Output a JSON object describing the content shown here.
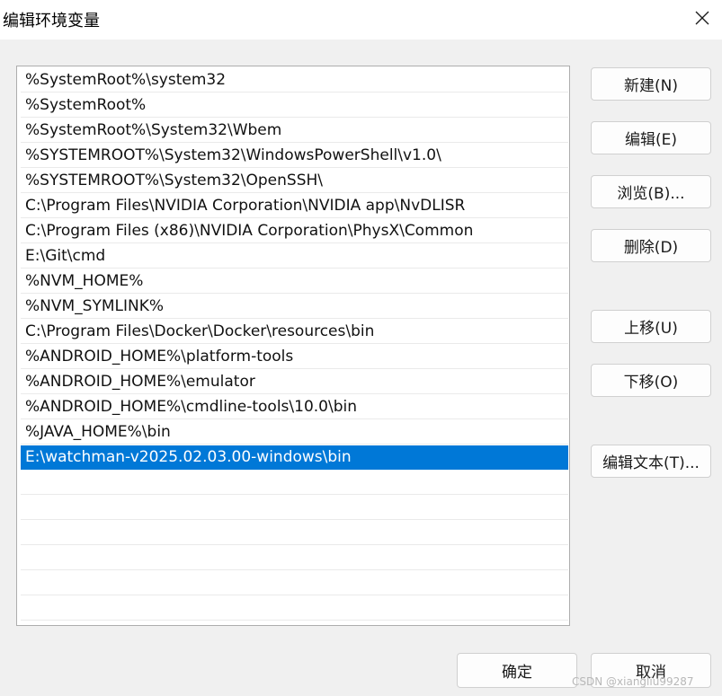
{
  "window": {
    "title": "编辑环境变量"
  },
  "icons": {
    "close": "close-icon"
  },
  "path_list": {
    "items": [
      "%SystemRoot%\\system32",
      "%SystemRoot%",
      "%SystemRoot%\\System32\\Wbem",
      "%SYSTEMROOT%\\System32\\WindowsPowerShell\\v1.0\\",
      "%SYSTEMROOT%\\System32\\OpenSSH\\",
      "C:\\Program Files\\NVIDIA Corporation\\NVIDIA app\\NvDLISR",
      "C:\\Program Files (x86)\\NVIDIA Corporation\\PhysX\\Common",
      "E:\\Git\\cmd",
      "%NVM_HOME%",
      "%NVM_SYMLINK%",
      "C:\\Program Files\\Docker\\Docker\\resources\\bin",
      "%ANDROID_HOME%\\platform-tools",
      "%ANDROID_HOME%\\emulator",
      "%ANDROID_HOME%\\cmdline-tools\\10.0\\bin",
      "%JAVA_HOME%\\bin",
      "E:\\watchman-v2025.02.03.00-windows\\bin"
    ],
    "selected_index": 15,
    "selection_color": "#0078d7"
  },
  "buttons": {
    "new": "新建(N)",
    "edit": "编辑(E)",
    "browse": "浏览(B)...",
    "delete": "删除(D)",
    "move_up": "上移(U)",
    "move_down": "下移(O)",
    "edit_text": "编辑文本(T)..."
  },
  "footer": {
    "ok": "确定",
    "cancel": "取消"
  },
  "watermark": "CSDN @xiangliu99287"
}
